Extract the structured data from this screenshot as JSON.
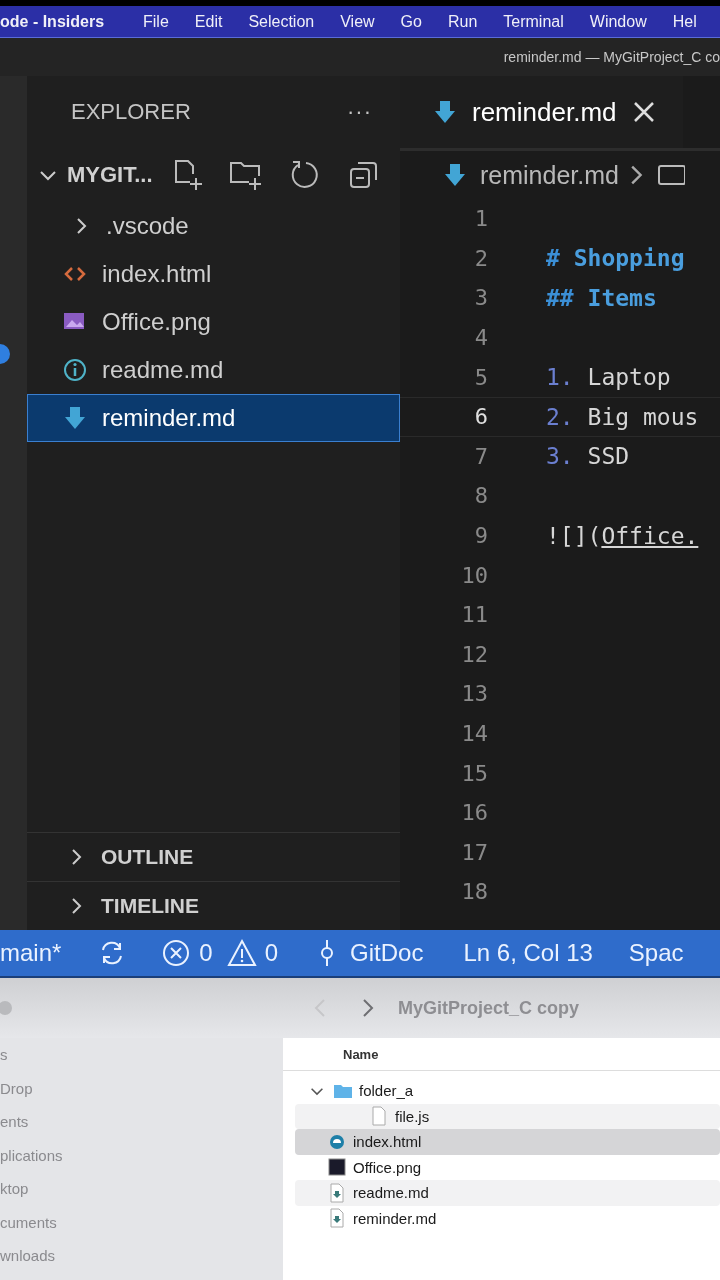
{
  "menu_bar": {
    "app": "ode - Insiders",
    "items": [
      "File",
      "Edit",
      "Selection",
      "View",
      "Go",
      "Run",
      "Terminal",
      "Window",
      "Hel"
    ]
  },
  "window": {
    "title": "reminder.md — MyGitProject_C co"
  },
  "explorer": {
    "title": "EXPLORER",
    "more": "···",
    "folder": {
      "label": "MYGIT...",
      "expanded": true
    },
    "items": [
      {
        "label": ".vscode",
        "kind": "folder",
        "selected": false
      },
      {
        "label": "index.html",
        "kind": "html",
        "selected": false
      },
      {
        "label": "Office.png",
        "kind": "image",
        "selected": false
      },
      {
        "label": "readme.md",
        "kind": "info",
        "selected": false
      },
      {
        "label": "reminder.md",
        "kind": "markdown",
        "selected": true
      }
    ],
    "sections": [
      {
        "label": "OUTLINE",
        "expanded": false
      },
      {
        "label": "TIMELINE",
        "expanded": false
      }
    ]
  },
  "editor": {
    "tabs": [
      {
        "label": "reminder.md",
        "selected": true
      }
    ],
    "breadcrumb": [
      "reminder.md"
    ],
    "lines": [
      {
        "number": "1",
        "active": false
      },
      {
        "number": "2",
        "active": false,
        "tokens": [
          {
            "kind": "mark",
            "text": "# "
          },
          {
            "kind": "heading",
            "text": "Shopping"
          }
        ]
      },
      {
        "number": "3",
        "active": false,
        "tokens": [
          {
            "kind": "mark",
            "text": "## "
          },
          {
            "kind": "heading",
            "text": "Items"
          }
        ]
      },
      {
        "number": "4",
        "active": false
      },
      {
        "number": "5",
        "active": false,
        "tokens": [
          {
            "kind": "list",
            "text": "1. "
          },
          {
            "kind": "plain",
            "text": "Laptop"
          }
        ]
      },
      {
        "number": "6",
        "active": true,
        "tokens": [
          {
            "kind": "list",
            "text": "2. "
          },
          {
            "kind": "plain",
            "text": "Big mous"
          }
        ]
      },
      {
        "number": "7",
        "active": false,
        "tokens": [
          {
            "kind": "list",
            "text": "3. "
          },
          {
            "kind": "plain",
            "text": "SSD"
          }
        ]
      },
      {
        "number": "8",
        "active": false
      },
      {
        "number": "9",
        "active": false,
        "tokens": [
          {
            "kind": "plain",
            "text": "![]("
          },
          {
            "kind": "link",
            "text": "Office."
          }
        ]
      },
      {
        "number": "10",
        "active": false
      },
      {
        "number": "11",
        "active": false
      },
      {
        "number": "12",
        "active": false
      },
      {
        "number": "13",
        "active": false
      },
      {
        "number": "14",
        "active": false
      },
      {
        "number": "15",
        "active": false
      },
      {
        "number": "16",
        "active": false
      },
      {
        "number": "17",
        "active": false
      },
      {
        "number": "18",
        "active": false
      }
    ]
  },
  "status_bar": [
    {
      "kind": "branch",
      "text": "main*"
    },
    {
      "kind": "sync"
    },
    {
      "kind": "errors",
      "text": "0"
    },
    {
      "kind": "warnings",
      "text": "0"
    },
    {
      "kind": "commit",
      "text": "GitDoc"
    },
    {
      "kind": "plain",
      "text": "Ln 6, Col 13"
    },
    {
      "kind": "plain",
      "text": "Spac"
    }
  ],
  "finder": {
    "title": "MyGitProject_C copy",
    "sidebar": [
      "s",
      "Drop",
      "ents",
      "plications",
      "ktop",
      "cuments",
      "wnloads"
    ],
    "column": "Name",
    "rows": [
      {
        "label": "folder_a",
        "kind": "folder",
        "expanded": true,
        "selected": false,
        "children": [
          {
            "label": "file.js",
            "kind": "js",
            "selected": false
          }
        ]
      },
      {
        "label": "index.html",
        "kind": "html",
        "selected": true
      },
      {
        "label": "Office.png",
        "kind": "image",
        "selected": false
      },
      {
        "label": "readme.md",
        "kind": "markdown",
        "selected": false
      },
      {
        "label": "reminder.md",
        "kind": "markdown",
        "selected": false
      }
    ]
  }
}
